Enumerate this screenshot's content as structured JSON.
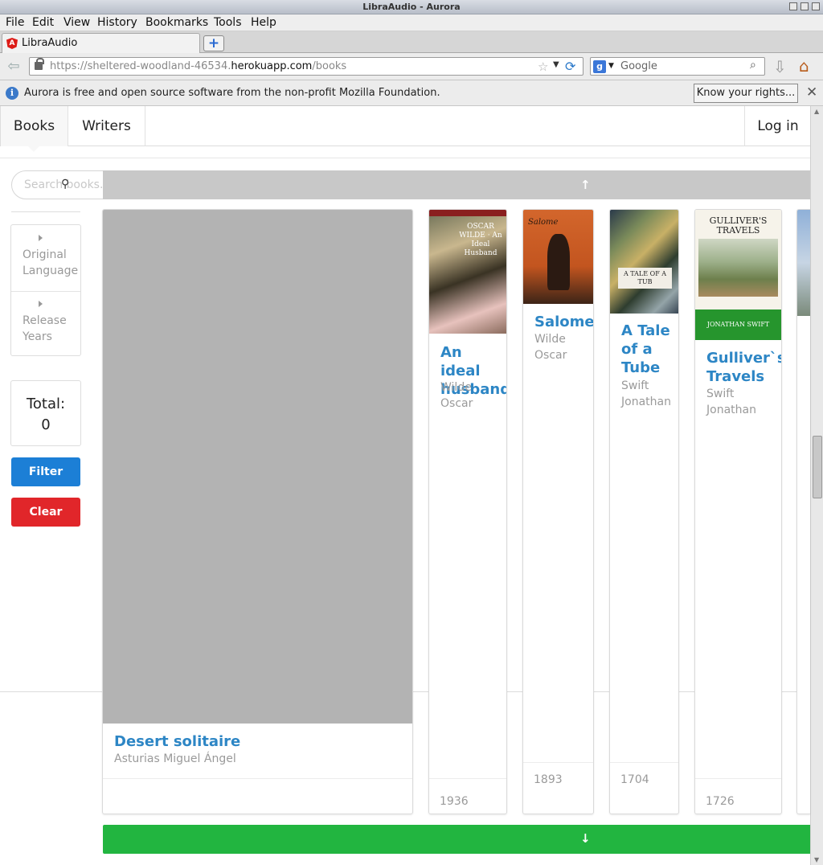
{
  "window": {
    "title": "LibraAudio - Aurora",
    "menu": [
      "File",
      "Edit",
      "View",
      "History",
      "Bookmarks",
      "Tools",
      "Help"
    ],
    "menu_accel": [
      "F",
      "E",
      "V",
      "s",
      "B",
      "T",
      "H"
    ],
    "tab_title": "LibraAudio",
    "url_prefix": "https://sheltered-woodland-46534.",
    "url_domain": "herokuapp.com",
    "url_path": "/books",
    "search_placeholder": "Google",
    "infobar_message": "Aurora is free and open source software from the non-profit Mozilla Foundation.",
    "infobar_button": "Know your rights..."
  },
  "app": {
    "nav": {
      "books": "Books",
      "writers": "Writers",
      "login": "Log in"
    },
    "search_placeholder": "Search books...",
    "filters": [
      {
        "label": "Original Language"
      },
      {
        "label": "Release Years"
      }
    ],
    "total_label": "Total:",
    "total_value": "0",
    "filter_button": "Filter",
    "clear_button": "Clear"
  },
  "books": [
    {
      "title": "Desert solitaire",
      "author": "Asturias Miguel Ángel",
      "year": ""
    },
    {
      "title": "An ideal husband",
      "author": "Wilde Oscar",
      "year": "1936",
      "cover_text": "OSCAR WILDE · An Ideal Husband"
    },
    {
      "title": "Salome",
      "author": "Wilde Oscar",
      "year": "1893",
      "cover_text": "Salome"
    },
    {
      "title": "A Tale of a Tube",
      "author": "Swift Jonathan",
      "year": "1704",
      "cover_text": "A TALE OF A TUB"
    },
    {
      "title": "Gulliver`s Travels",
      "author": "Swift Jonathan",
      "year": "1726",
      "cover_text_top": "GULLIVER'S TRAVELS",
      "cover_text_bottom": "JONATHAN SWIFT"
    }
  ],
  "colors": {
    "accent_blue": "#1c7fd6",
    "danger_red": "#e1262a",
    "success_green": "#22b540",
    "title_link": "#2d86c5"
  }
}
